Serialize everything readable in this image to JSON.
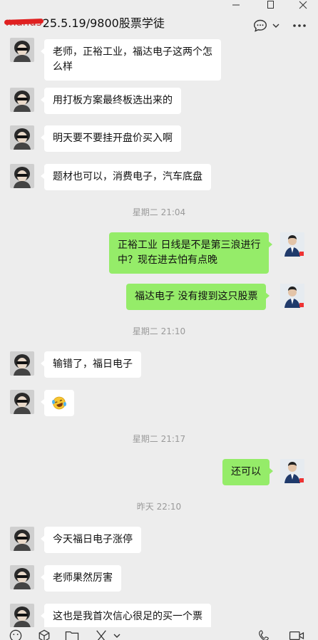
{
  "window": {
    "title_redacted": "manus",
    "title": "25.5.19/9800股票学徒",
    "controls": [
      "minimize-icon",
      "maximize-icon",
      "close-icon"
    ],
    "chat_actions": [
      "chat-bubble-icon",
      "chevron-down-icon",
      "more-icon"
    ]
  },
  "messages": [
    {
      "type": "in",
      "text_lines": [
        "老师，正裕工业，福达电子这两个怎",
        "么样"
      ]
    },
    {
      "type": "in",
      "text_lines": [
        "用打板方案最终板选出来的"
      ]
    },
    {
      "type": "in",
      "text_lines": [
        "明天要不要挂开盘价买入啊"
      ]
    },
    {
      "type": "in",
      "text_lines": [
        "题材也可以，消费电子，汽车底盘"
      ]
    },
    {
      "type": "time",
      "text": "星期二 21:04"
    },
    {
      "type": "out",
      "text_lines": [
        "正裕工业 日线是不是第三浪进行",
        "中？现在进去怕有点晚"
      ]
    },
    {
      "type": "out",
      "text_lines": [
        "福达电子  没有搜到这只股票"
      ]
    },
    {
      "type": "time",
      "text": "星期二 21:10"
    },
    {
      "type": "in",
      "text_lines": [
        "输错了，福日电子"
      ]
    },
    {
      "type": "in",
      "emoji": "laughing-tears-emoji"
    },
    {
      "type": "time",
      "text": "星期二 21:17"
    },
    {
      "type": "out",
      "text_lines": [
        "还可以"
      ]
    },
    {
      "type": "time",
      "text": "昨天 22:10"
    },
    {
      "type": "in",
      "text_lines": [
        "今天福日电子涨停"
      ]
    },
    {
      "type": "in",
      "text_lines": [
        "老师果然厉害"
      ]
    },
    {
      "type": "in",
      "text_lines": [
        "这也是我首次信心很足的买一个票"
      ]
    }
  ],
  "toolbar": {
    "icons": [
      "emoji-icon",
      "favorites-icon",
      "folder-icon",
      "screenshot-icon",
      "chevron-down-icon",
      "voice-call-icon",
      "video-call-icon"
    ]
  },
  "colors": {
    "background": "#ededed",
    "incoming": "#ffffff",
    "outgoing": "#95ec69",
    "timestamp": "#9a9a9a"
  }
}
